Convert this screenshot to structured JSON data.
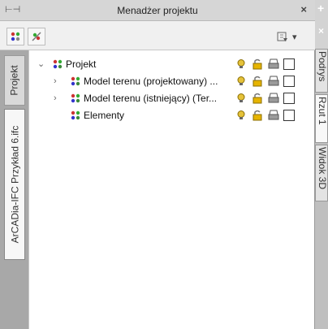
{
  "panel": {
    "title": "Menadżer projektu",
    "close_glyph": "×",
    "pin_glyph": "⊢⊣"
  },
  "toolbar": {
    "buttons": [
      {
        "icon": "layers-settings-icon"
      },
      {
        "icon": "layers-edit-icon"
      }
    ],
    "filter": {
      "icon": "filter-icon",
      "arrow": "▾"
    }
  },
  "left_tabs": [
    {
      "label": "Projekt",
      "active": false
    },
    {
      "label": "ArCADia-IFC Przykład 6.ifc",
      "active": true
    }
  ],
  "tree": {
    "items": [
      {
        "label": "Projekt",
        "expanded": true,
        "has_children": true,
        "level": 0
      },
      {
        "label": "Model terenu  (projektowany) ...",
        "expanded": false,
        "has_children": true,
        "level": 1
      },
      {
        "label": "Model terenu  (istniejący) (Ter...",
        "expanded": false,
        "has_children": true,
        "level": 1
      },
      {
        "label": "Elementy",
        "expanded": false,
        "has_children": false,
        "level": 1
      }
    ]
  },
  "right_strip": {
    "plus": "+",
    "x": "×",
    "tabs": [
      {
        "label": "Podrys",
        "active": false
      },
      {
        "label": "Rzut 1",
        "active": true
      },
      {
        "label": "Widok 3D",
        "active": false
      }
    ]
  },
  "colors": {
    "bulb": "#e5c23a",
    "lock": "#e6b400",
    "printer": "#6a6a6a",
    "node_icon": "#3c8a3c"
  }
}
